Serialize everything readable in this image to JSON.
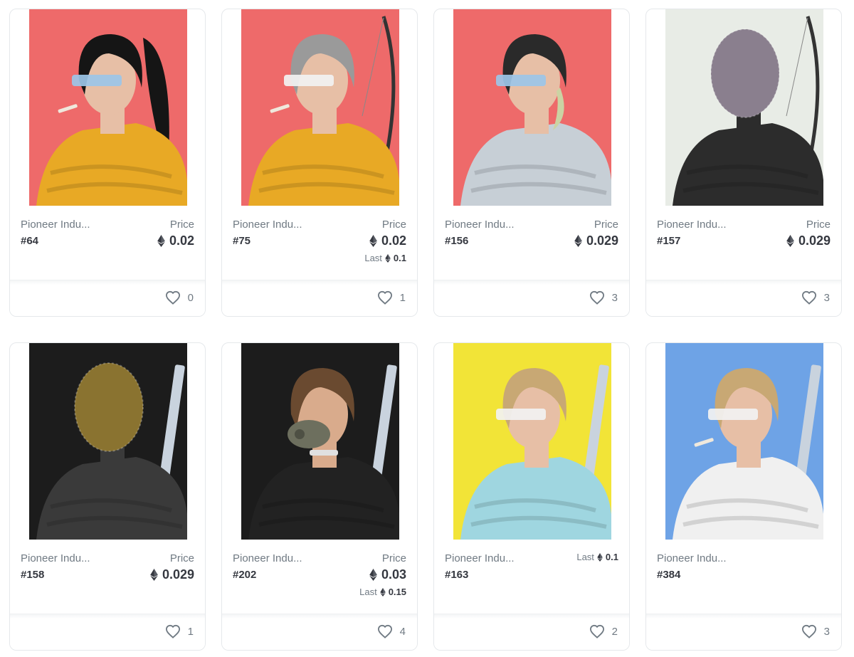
{
  "colors": {
    "card_border": "#e5e8eb",
    "text_primary": "#353840",
    "text_secondary": "#707a83"
  },
  "icons": {
    "currency": "ethereum-icon",
    "favorite": "heart-outline-icon"
  },
  "cards": [
    {
      "collection": "Pioneer Indu...",
      "token_id": "#64",
      "price_label": "Price",
      "price": "0.02",
      "last_label": "",
      "last_price": "",
      "likes": "0",
      "bg": "#ee6a6a",
      "variant": "yellow-jacket-ponytail"
    },
    {
      "collection": "Pioneer Indu...",
      "token_id": "#75",
      "price_label": "Price",
      "price": "0.02",
      "last_label": "Last",
      "last_price": "0.1",
      "likes": "1",
      "bg": "#ee6a6a",
      "variant": "yellow-jacket-grey-bob"
    },
    {
      "collection": "Pioneer Indu...",
      "token_id": "#156",
      "price_label": "Price",
      "price": "0.029",
      "last_label": "",
      "last_price": "",
      "likes": "3",
      "bg": "#ee6a6a",
      "variant": "silver-jacket"
    },
    {
      "collection": "Pioneer Indu...",
      "token_id": "#157",
      "price_label": "Price",
      "price": "0.029",
      "last_label": "",
      "last_price": "",
      "likes": "3",
      "bg": "#e8ece6",
      "variant": "mesh-mask-dark"
    },
    {
      "collection": "Pioneer Indu...",
      "token_id": "#158",
      "price_label": "Price",
      "price": "0.029",
      "last_label": "",
      "last_price": "",
      "likes": "1",
      "bg": "#1c1c1c",
      "variant": "gold-mask-dark"
    },
    {
      "collection": "Pioneer Indu...",
      "token_id": "#202",
      "price_label": "Price",
      "price": "0.03",
      "last_label": "Last",
      "last_price": "0.15",
      "likes": "4",
      "bg": "#1c1c1c",
      "variant": "respirator-leather"
    },
    {
      "collection": "Pioneer Indu...",
      "token_id": "#163",
      "price_label": "",
      "price": "",
      "last_label": "Last",
      "last_price": "0.1",
      "likes": "2",
      "bg": "#f2e437",
      "variant": "blue-jacket-blonde"
    },
    {
      "collection": "Pioneer Indu...",
      "token_id": "#384",
      "price_label": "",
      "price": "",
      "last_label": "",
      "last_price": "",
      "likes": "3",
      "bg": "#6ea3e6",
      "variant": "white-jacket-blonde"
    }
  ]
}
